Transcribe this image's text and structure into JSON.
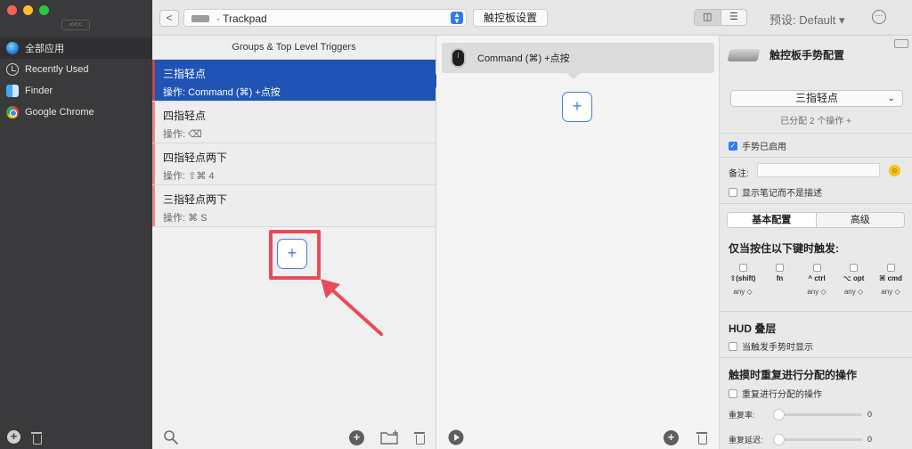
{
  "colors": {
    "accent": "#2f7bf5",
    "selected_row": "#1f54b4",
    "highlight": "#e94b5a"
  },
  "sidebar": {
    "collapse_label": "<<<",
    "items": [
      {
        "label": "全部应用",
        "icon": "globe-icon"
      },
      {
        "label": "Recently Used",
        "icon": "clock-icon"
      },
      {
        "label": "Finder",
        "icon": "finder-icon"
      },
      {
        "label": "Google Chrome",
        "icon": "chrome-icon"
      }
    ]
  },
  "toolbar": {
    "back_label": "<",
    "device": "· Trackpad",
    "trackpad_settings": "触控板设置",
    "preset": "预设: Default ▾",
    "more": "···"
  },
  "triggers": {
    "header": "Groups & Top Level Triggers",
    "rows": [
      {
        "title": "三指轻点",
        "sub": "操作: Command (⌘) +点按"
      },
      {
        "title": "四指轻点",
        "sub": "操作: ⌫"
      },
      {
        "title": "四指轻点两下",
        "sub": "操作: ⇧⌘ 4"
      },
      {
        "title": "三指轻点两下",
        "sub": "操作: ⌘ S"
      }
    ],
    "add_label": "+"
  },
  "actions": {
    "rows": [
      {
        "title": "Command (⌘) +点按"
      }
    ],
    "add_label": "+"
  },
  "config": {
    "title": "触控板手势配置",
    "gesture_select": "三指轻点",
    "assigned": "已分配 2 个操作 +",
    "enabled_label": "手势已启用",
    "notes_label": "备注:",
    "show_notes_label": "显示笔记而不是描述",
    "tabs": [
      "基本配置",
      "高级"
    ],
    "modifiers_title": "仅当按住以下键时触发:",
    "modifiers": [
      {
        "label": "⇧(shift)",
        "any": "any ◇"
      },
      {
        "label": "fn",
        "any": ""
      },
      {
        "label": "^ ctrl",
        "any": "any ◇"
      },
      {
        "label": "⌥ opt",
        "any": "any ◇"
      },
      {
        "label": "⌘ cmd",
        "any": "any ◇"
      }
    ],
    "hud_title": "HUD 叠层",
    "hud_check": "当触发手势时显示",
    "repeat_title": "触摸时重复进行分配的操作",
    "repeat_check": "重复进行分配的操作",
    "repeat_rate_label": "重复率:",
    "repeat_rate_value": "0",
    "repeat_delay_label": "重复延迟:",
    "repeat_delay_value": "0"
  }
}
